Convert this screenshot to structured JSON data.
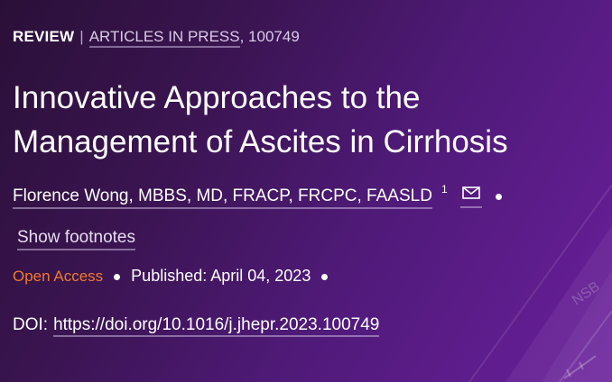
{
  "header": {
    "type_label": "REVIEW",
    "separator": "|",
    "section_link": "ARTICLES IN PRESS",
    "article_number": ", 100749"
  },
  "article": {
    "title": "Innovative Approaches to the Management of Ascites in Cirrhosis",
    "author": "Florence Wong, MBBS, MD, FRACP, FRCPC, FAASLD",
    "author_affiliation_sup": "1",
    "show_footnotes": "Show footnotes",
    "open_access": "Open Access",
    "published_label": "Published:",
    "published_date": "April 04, 2023",
    "doi_label": "DOI:",
    "doi_link": "https://doi.org/10.1016/j.jhepr.2023.100749"
  },
  "background": {
    "watermark_text": "NSB"
  },
  "colors": {
    "open_access": "#f07a2c",
    "background_start": "#2a1038",
    "background_end": "#6a1f9c",
    "text": "#ffffff"
  },
  "icons": {
    "email": "mail-icon"
  }
}
